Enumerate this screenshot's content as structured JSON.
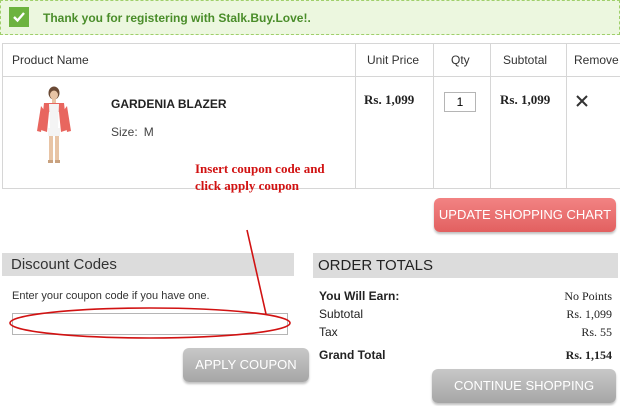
{
  "banner": {
    "message": "Thank you for registering with Stalk.Buy.Love!."
  },
  "cart": {
    "headers": {
      "product": "Product Name",
      "unit_price": "Unit Price",
      "qty": "Qty",
      "subtotal": "Subtotal",
      "remove": "Remove"
    },
    "item": {
      "name": "GARDENIA BLAZER",
      "size_label": "Size:",
      "size_value": "M",
      "unit_price": "Rs. 1,099",
      "qty": "1",
      "subtotal": "Rs. 1,099"
    }
  },
  "annotation": {
    "text": "Insert coupon code and click apply coupon"
  },
  "buttons": {
    "update": "UPDATE SHOPPING CHART",
    "apply": "APPLY COUPON",
    "continue": "CONTINUE SHOPPING"
  },
  "discount": {
    "title": "Discount Codes",
    "description": "Enter your coupon code if you have one.",
    "coupon_value": ""
  },
  "totals": {
    "title": "ORDER TOTALS",
    "earn_label": "You Will Earn:",
    "earn_value": "No Points",
    "subtotal_label": "Subtotal",
    "subtotal_value": "Rs. 1,099",
    "tax_label": "Tax",
    "tax_value": "Rs. 55",
    "grand_label": "Grand Total",
    "grand_value": "Rs. 1,154"
  },
  "colors": {
    "accent_red": "#d11212",
    "update_button": "#e86d6d",
    "success_green": "#6db33f"
  },
  "icons": {
    "check": "check-icon",
    "remove": "close-icon"
  }
}
